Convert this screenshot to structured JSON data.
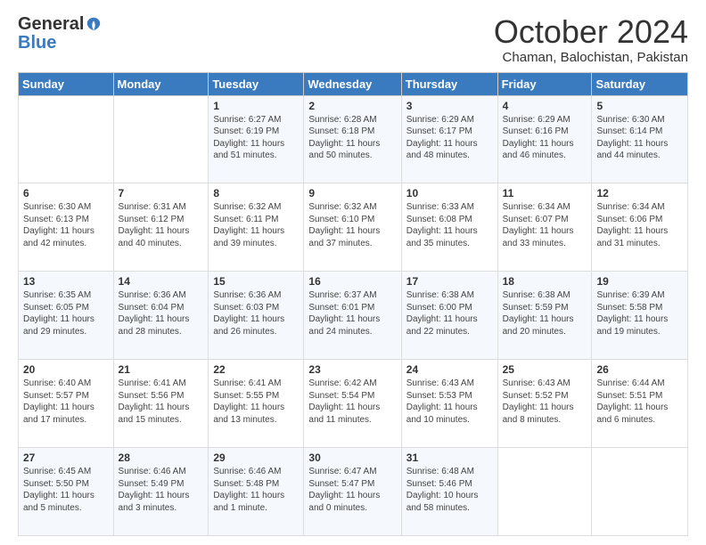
{
  "header": {
    "logo_general": "General",
    "logo_blue": "Blue",
    "month_title": "October 2024",
    "location": "Chaman, Balochistan, Pakistan"
  },
  "weekdays": [
    "Sunday",
    "Monday",
    "Tuesday",
    "Wednesday",
    "Thursday",
    "Friday",
    "Saturday"
  ],
  "weeks": [
    [
      {
        "day": "",
        "sunrise": "",
        "sunset": "",
        "daylight": ""
      },
      {
        "day": "",
        "sunrise": "",
        "sunset": "",
        "daylight": ""
      },
      {
        "day": "1",
        "sunrise": "Sunrise: 6:27 AM",
        "sunset": "Sunset: 6:19 PM",
        "daylight": "Daylight: 11 hours and 51 minutes."
      },
      {
        "day": "2",
        "sunrise": "Sunrise: 6:28 AM",
        "sunset": "Sunset: 6:18 PM",
        "daylight": "Daylight: 11 hours and 50 minutes."
      },
      {
        "day": "3",
        "sunrise": "Sunrise: 6:29 AM",
        "sunset": "Sunset: 6:17 PM",
        "daylight": "Daylight: 11 hours and 48 minutes."
      },
      {
        "day": "4",
        "sunrise": "Sunrise: 6:29 AM",
        "sunset": "Sunset: 6:16 PM",
        "daylight": "Daylight: 11 hours and 46 minutes."
      },
      {
        "day": "5",
        "sunrise": "Sunrise: 6:30 AM",
        "sunset": "Sunset: 6:14 PM",
        "daylight": "Daylight: 11 hours and 44 minutes."
      }
    ],
    [
      {
        "day": "6",
        "sunrise": "Sunrise: 6:30 AM",
        "sunset": "Sunset: 6:13 PM",
        "daylight": "Daylight: 11 hours and 42 minutes."
      },
      {
        "day": "7",
        "sunrise": "Sunrise: 6:31 AM",
        "sunset": "Sunset: 6:12 PM",
        "daylight": "Daylight: 11 hours and 40 minutes."
      },
      {
        "day": "8",
        "sunrise": "Sunrise: 6:32 AM",
        "sunset": "Sunset: 6:11 PM",
        "daylight": "Daylight: 11 hours and 39 minutes."
      },
      {
        "day": "9",
        "sunrise": "Sunrise: 6:32 AM",
        "sunset": "Sunset: 6:10 PM",
        "daylight": "Daylight: 11 hours and 37 minutes."
      },
      {
        "day": "10",
        "sunrise": "Sunrise: 6:33 AM",
        "sunset": "Sunset: 6:08 PM",
        "daylight": "Daylight: 11 hours and 35 minutes."
      },
      {
        "day": "11",
        "sunrise": "Sunrise: 6:34 AM",
        "sunset": "Sunset: 6:07 PM",
        "daylight": "Daylight: 11 hours and 33 minutes."
      },
      {
        "day": "12",
        "sunrise": "Sunrise: 6:34 AM",
        "sunset": "Sunset: 6:06 PM",
        "daylight": "Daylight: 11 hours and 31 minutes."
      }
    ],
    [
      {
        "day": "13",
        "sunrise": "Sunrise: 6:35 AM",
        "sunset": "Sunset: 6:05 PM",
        "daylight": "Daylight: 11 hours and 29 minutes."
      },
      {
        "day": "14",
        "sunrise": "Sunrise: 6:36 AM",
        "sunset": "Sunset: 6:04 PM",
        "daylight": "Daylight: 11 hours and 28 minutes."
      },
      {
        "day": "15",
        "sunrise": "Sunrise: 6:36 AM",
        "sunset": "Sunset: 6:03 PM",
        "daylight": "Daylight: 11 hours and 26 minutes."
      },
      {
        "day": "16",
        "sunrise": "Sunrise: 6:37 AM",
        "sunset": "Sunset: 6:01 PM",
        "daylight": "Daylight: 11 hours and 24 minutes."
      },
      {
        "day": "17",
        "sunrise": "Sunrise: 6:38 AM",
        "sunset": "Sunset: 6:00 PM",
        "daylight": "Daylight: 11 hours and 22 minutes."
      },
      {
        "day": "18",
        "sunrise": "Sunrise: 6:38 AM",
        "sunset": "Sunset: 5:59 PM",
        "daylight": "Daylight: 11 hours and 20 minutes."
      },
      {
        "day": "19",
        "sunrise": "Sunrise: 6:39 AM",
        "sunset": "Sunset: 5:58 PM",
        "daylight": "Daylight: 11 hours and 19 minutes."
      }
    ],
    [
      {
        "day": "20",
        "sunrise": "Sunrise: 6:40 AM",
        "sunset": "Sunset: 5:57 PM",
        "daylight": "Daylight: 11 hours and 17 minutes."
      },
      {
        "day": "21",
        "sunrise": "Sunrise: 6:41 AM",
        "sunset": "Sunset: 5:56 PM",
        "daylight": "Daylight: 11 hours and 15 minutes."
      },
      {
        "day": "22",
        "sunrise": "Sunrise: 6:41 AM",
        "sunset": "Sunset: 5:55 PM",
        "daylight": "Daylight: 11 hours and 13 minutes."
      },
      {
        "day": "23",
        "sunrise": "Sunrise: 6:42 AM",
        "sunset": "Sunset: 5:54 PM",
        "daylight": "Daylight: 11 hours and 11 minutes."
      },
      {
        "day": "24",
        "sunrise": "Sunrise: 6:43 AM",
        "sunset": "Sunset: 5:53 PM",
        "daylight": "Daylight: 11 hours and 10 minutes."
      },
      {
        "day": "25",
        "sunrise": "Sunrise: 6:43 AM",
        "sunset": "Sunset: 5:52 PM",
        "daylight": "Daylight: 11 hours and 8 minutes."
      },
      {
        "day": "26",
        "sunrise": "Sunrise: 6:44 AM",
        "sunset": "Sunset: 5:51 PM",
        "daylight": "Daylight: 11 hours and 6 minutes."
      }
    ],
    [
      {
        "day": "27",
        "sunrise": "Sunrise: 6:45 AM",
        "sunset": "Sunset: 5:50 PM",
        "daylight": "Daylight: 11 hours and 5 minutes."
      },
      {
        "day": "28",
        "sunrise": "Sunrise: 6:46 AM",
        "sunset": "Sunset: 5:49 PM",
        "daylight": "Daylight: 11 hours and 3 minutes."
      },
      {
        "day": "29",
        "sunrise": "Sunrise: 6:46 AM",
        "sunset": "Sunset: 5:48 PM",
        "daylight": "Daylight: 11 hours and 1 minute."
      },
      {
        "day": "30",
        "sunrise": "Sunrise: 6:47 AM",
        "sunset": "Sunset: 5:47 PM",
        "daylight": "Daylight: 11 hours and 0 minutes."
      },
      {
        "day": "31",
        "sunrise": "Sunrise: 6:48 AM",
        "sunset": "Sunset: 5:46 PM",
        "daylight": "Daylight: 10 hours and 58 minutes."
      },
      {
        "day": "",
        "sunrise": "",
        "sunset": "",
        "daylight": ""
      },
      {
        "day": "",
        "sunrise": "",
        "sunset": "",
        "daylight": ""
      }
    ]
  ]
}
